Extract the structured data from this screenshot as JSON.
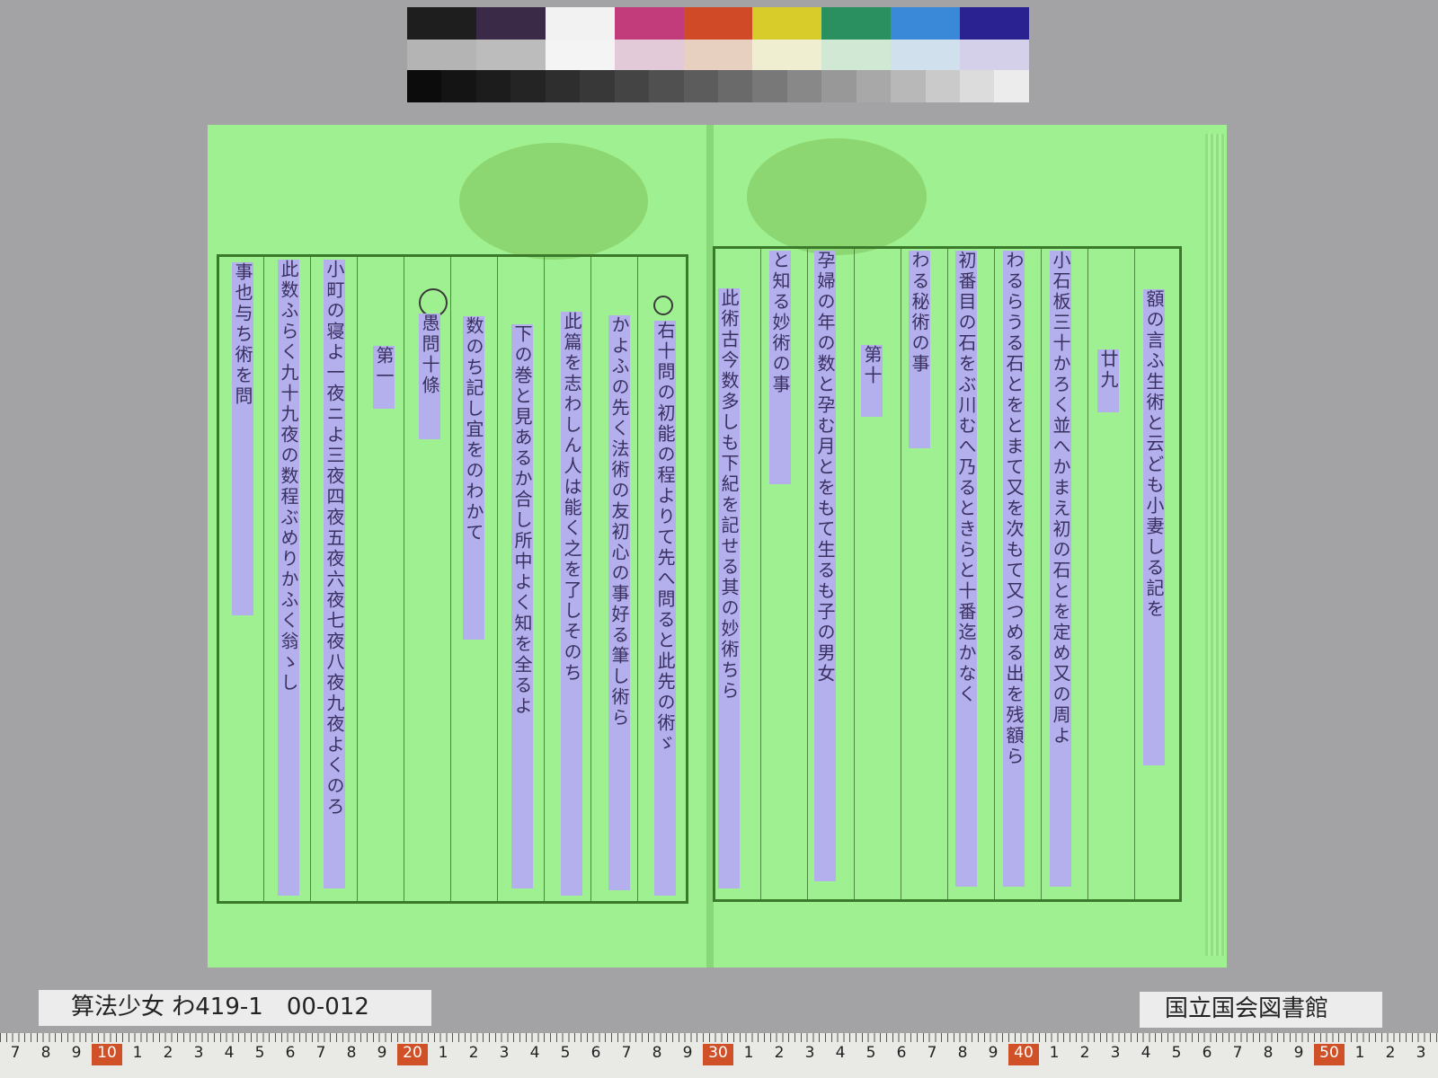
{
  "color_chart": {
    "top_row": [
      "#1e1e1e",
      "#3a2a48",
      "#f2f2f2",
      "#c23c7c",
      "#d04a28",
      "#d8cc2a",
      "#2a9060",
      "#3a88d8",
      "#2a2290"
    ],
    "mid_row": [
      "#b4b4b4",
      "#bcbcbc",
      "#f4f4f4",
      "#e2cad8",
      "#e8d0c0",
      "#f0eed0",
      "#d0e8d4",
      "#d0e0ec",
      "#d4d0ea"
    ],
    "gray_steps": [
      "#0c0c0c",
      "#141414",
      "#1c1c1c",
      "#242424",
      "#2e2e2e",
      "#383838",
      "#444444",
      "#505050",
      "#5c5c5c",
      "#6a6a6a",
      "#787878",
      "#888888",
      "#989898",
      "#a8a8a8",
      "#b8b8b8",
      "#cacaca",
      "#dcdcdc",
      "#ececec"
    ]
  },
  "book": {
    "page_color": "#9ff090",
    "highlight_color": "#b4b0ee",
    "right_page_columns": [
      "額の言ふ生術と云ども小妻しる記を",
      "廿九",
      "小石板三十かろく並へかまえ初の石とを定め又の周よ",
      "わるらうる石とをとまて又を次もて又つめる出を残額ら",
      "初番目の石をぶ川むへ乃るときらと十番迄かなく",
      "わる秘術の事",
      "第十",
      "と知る妙術の事",
      "孕婦の年の数と孕む月とをもて生るも子の男女",
      "此術古今数多しも下紀を記せる其の妙術ちら"
    ],
    "left_page_columns": [
      "右十問の初能の程よりて先へ問ると此先の術ゞ",
      "かよふの先く法術の友初心の事好る筆し術ら",
      "此篇を志わしん人は能く之を了しそのち",
      "下の巻と見あるか合し所中よく知を全るよ",
      "数のち記し宜をのわかて",
      "愚問十條",
      "第一",
      "小町の寝よ一夜ニよ三夜四夜五夜六夜七夜八夜九夜よくのろ",
      "此数ふらく九十九夜の数程ぶめりかふく翁ゝし",
      "事也与ち術を問"
    ]
  },
  "catalog_label": "算法少女 わ419-1　00-012",
  "library_label": "国立国会図書館",
  "ruler": {
    "numbers": [
      "7",
      "8",
      "9",
      "10",
      "1",
      "2",
      "3",
      "4",
      "5",
      "6",
      "7",
      "8",
      "9",
      "20",
      "1",
      "2",
      "3",
      "4",
      "5",
      "6",
      "7",
      "8",
      "9",
      "30",
      "1",
      "2",
      "3",
      "4",
      "5",
      "6",
      "7",
      "8",
      "9",
      "40",
      "1",
      "2",
      "3",
      "4",
      "5",
      "6",
      "7",
      "8",
      "9",
      "50",
      "1",
      "2",
      "3"
    ],
    "major": [
      "10",
      "20",
      "30",
      "40",
      "50"
    ]
  }
}
